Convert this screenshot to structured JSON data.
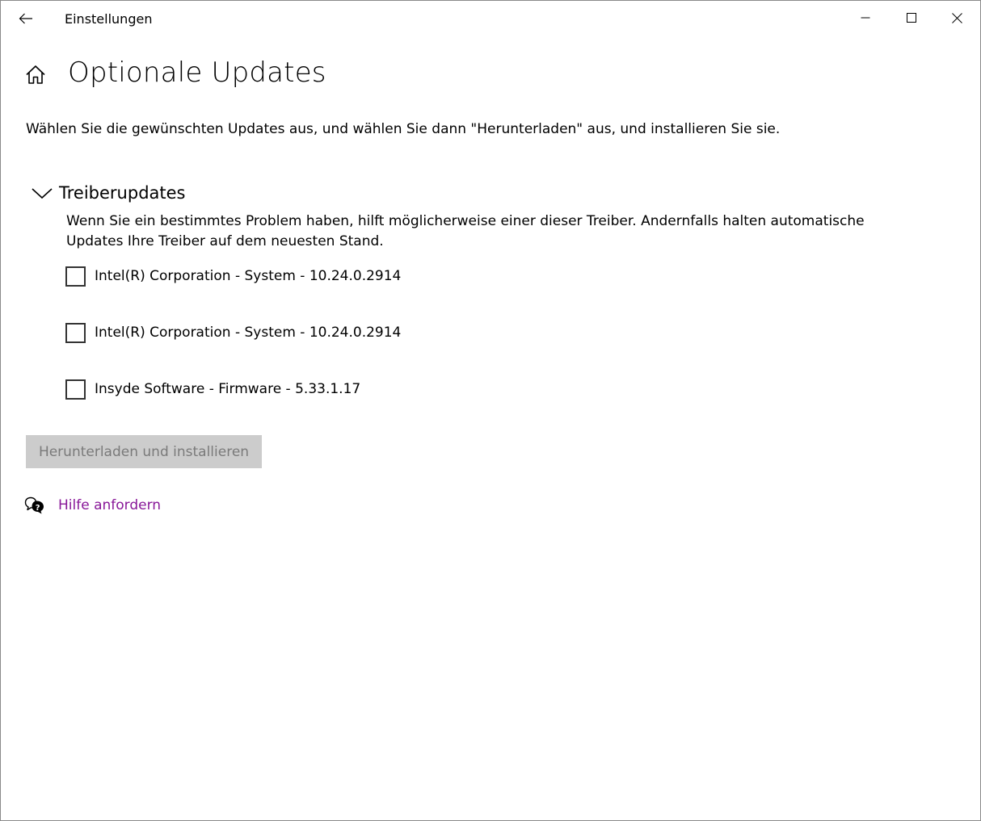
{
  "window": {
    "app_title": "Einstellungen",
    "controls": {
      "back_icon": "arrow-left-icon",
      "minimize_icon": "minimize-icon",
      "maximize_icon": "maximize-icon",
      "close_icon": "close-icon"
    }
  },
  "header": {
    "home_icon": "home-icon",
    "title": "Optionale Updates"
  },
  "intro_text": "Wählen Sie die gewünschten Updates aus, und wählen Sie dann \"Herunterladen\" aus, und installieren Sie sie.",
  "driver_section": {
    "title": "Treiberupdates",
    "expanded": true,
    "chevron_icon": "chevron-down-icon",
    "description": "Wenn Sie ein bestimmtes Problem haben, hilft möglicherweise einer dieser Treiber. Andernfalls halten automatische Updates Ihre Treiber auf dem neuesten Stand.",
    "items": [
      {
        "label": "Intel(R) Corporation - System - 10.24.0.2914",
        "checked": false
      },
      {
        "label": "Intel(R) Corporation - System - 10.24.0.2914",
        "checked": false
      },
      {
        "label": "Insyde Software - Firmware - 5.33.1.17",
        "checked": false
      }
    ]
  },
  "download_button": {
    "label": "Herunterladen und installieren",
    "enabled": false
  },
  "help": {
    "icon": "help-chat-icon",
    "link_text": "Hilfe anfordern"
  },
  "colors": {
    "link": "#881798",
    "button_disabled_bg": "#cccccc",
    "button_disabled_text": "#7a7a7a",
    "checkbox_border": "#333333"
  }
}
